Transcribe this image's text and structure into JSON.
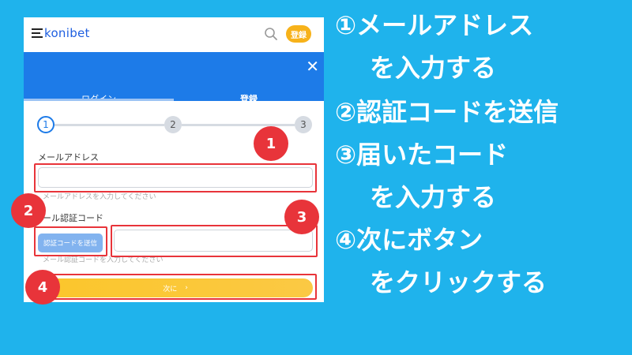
{
  "app": {
    "logo_text": "konibet",
    "register_label": "登録",
    "close_glyph": "✕"
  },
  "tabs": [
    {
      "label": "ログイン",
      "active": false
    },
    {
      "label": "登録",
      "active": true
    }
  ],
  "stepper": {
    "steps": [
      "1",
      "2",
      "3"
    ],
    "current": 1
  },
  "form": {
    "email_label": "メールアドレス",
    "email_value": "",
    "email_hint": "メールアドレスを入力してください",
    "code_label": "メール認証コード",
    "code_label_visible": "ール認証コード",
    "send_code_label": "認証コードを送信",
    "code_value": "",
    "code_hint": "メール認証コードを入力してください",
    "next_label": "次に",
    "next_arrow": "›"
  },
  "annotations": {
    "badges": [
      "1",
      "2",
      "3",
      "4"
    ],
    "color": "#e8343a"
  },
  "instructions": {
    "line1": "①メールアドレス",
    "line1b": "を入力する",
    "line2": "②認証コードを送信",
    "line3": "③届いたコード",
    "line3b": "を入力する",
    "line4": "④次にボタン",
    "line4b": "をクリックする"
  },
  "colors": {
    "background": "#1fb3ec",
    "primary_blue": "#1d7be8",
    "accent_yellow": "#fbc62b",
    "annotation_red": "#e8343a"
  }
}
